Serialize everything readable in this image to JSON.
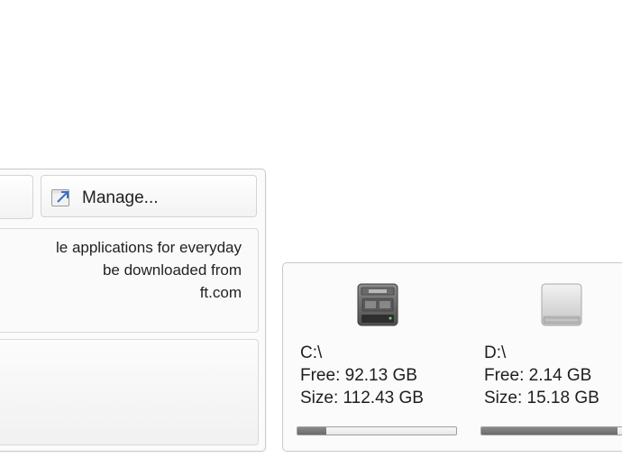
{
  "toolbar": {
    "manage_label": "Manage..."
  },
  "description": {
    "lines": [
      "le applications for everyday",
      "be downloaded from",
      "ft.com"
    ]
  },
  "drives": [
    {
      "name": "C:\\",
      "free": "Free: 92.13 GB",
      "size": "Size: 112.43 GB",
      "used_fraction": 0.18,
      "icon": "system-drive-icon"
    },
    {
      "name": "D:\\",
      "free": "Free: 2.14 GB",
      "size": "Size: 15.18 GB",
      "used_fraction": 0.86,
      "icon": "hard-drive-icon"
    }
  ],
  "colors": {
    "bar_fill": "#7a7a7a",
    "panel_border": "#c8c8c8"
  }
}
